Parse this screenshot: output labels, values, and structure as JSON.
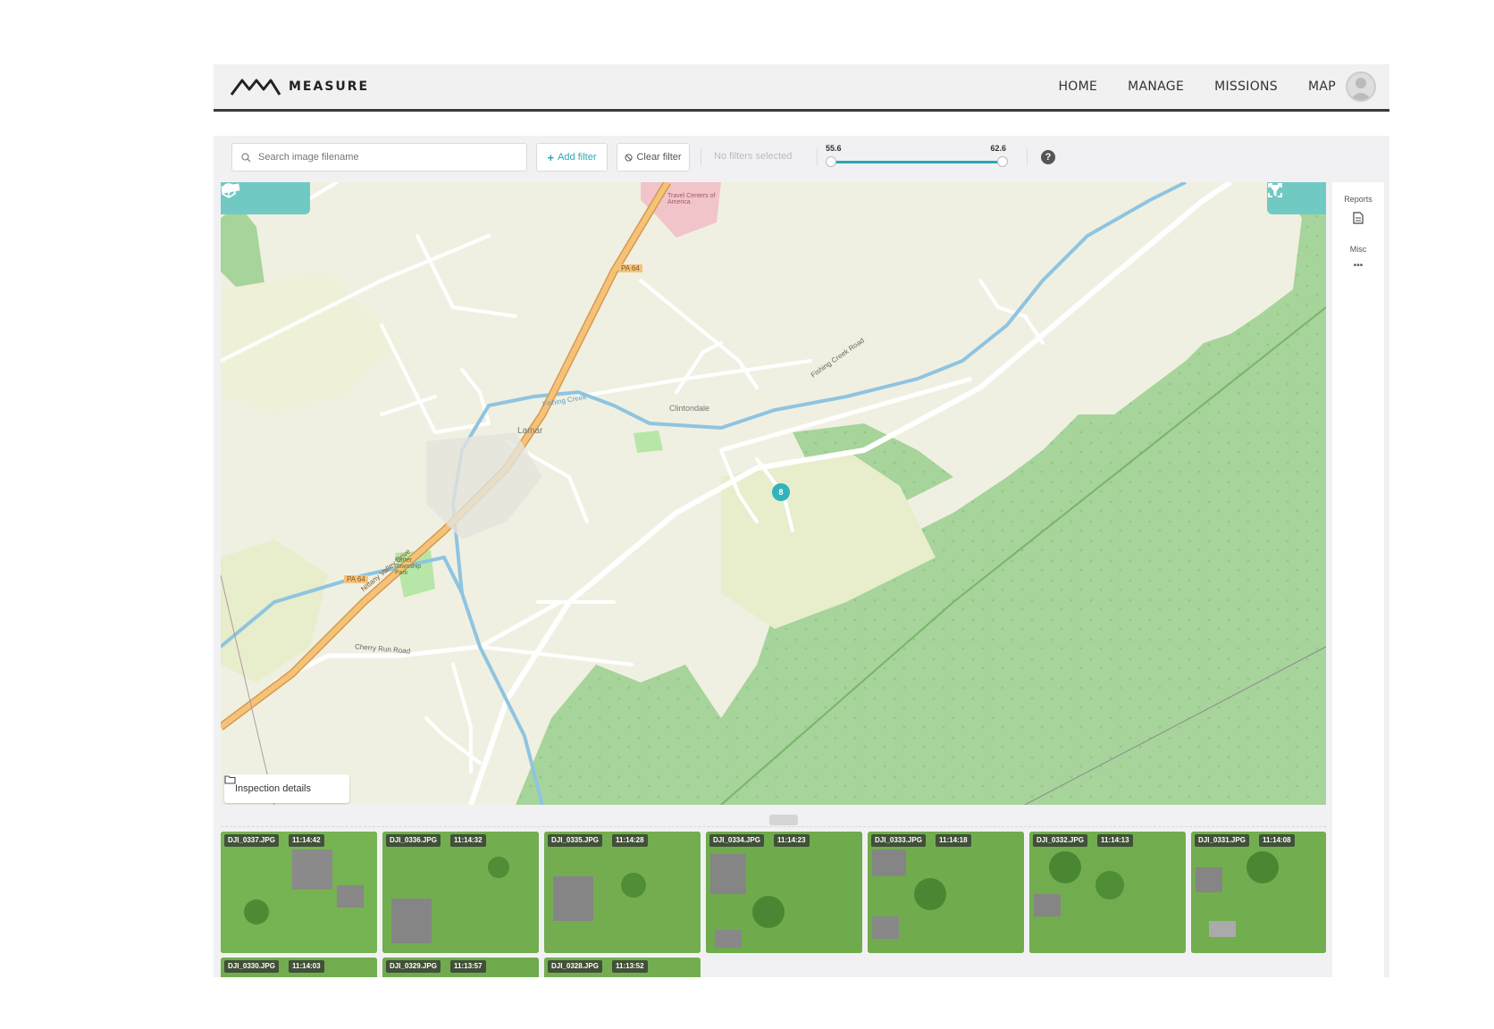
{
  "header": {
    "brand": "MEASURE",
    "nav": [
      "HOME",
      "MANAGE",
      "MISSIONS",
      "MAP"
    ]
  },
  "toolbar": {
    "search_placeholder": "Search image filename",
    "add_filter_label": "Add filter",
    "clear_filter_label": "Clear filter",
    "no_filters_text": "No filters selected",
    "slider_min": "55.6",
    "slider_max": "62.6",
    "help_label": "?"
  },
  "map": {
    "labels": {
      "place": "Lamar",
      "creek": "Fishing Creek",
      "road1": "Nittany Valley Drive",
      "route": "PA 64",
      "cherry": "Cherry Run Road",
      "fishing_road": "Fishing Creek Road",
      "park": "Porter Township Park",
      "village": "Clintondale",
      "travel": "Travel Centers of America"
    },
    "pin_label": "8",
    "inspection_label": "Inspection details"
  },
  "side": {
    "reports_label": "Reports",
    "misc_label": "Misc",
    "more_label": "•••"
  },
  "thumbnails": [
    {
      "name": "DJI_0337.JPG",
      "time": "11:14:42"
    },
    {
      "name": "DJI_0336.JPG",
      "time": "11:14:32"
    },
    {
      "name": "DJI_0335.JPG",
      "time": "11:14:28"
    },
    {
      "name": "DJI_0334.JPG",
      "time": "11:14:23"
    },
    {
      "name": "DJI_0333.JPG",
      "time": "11:14:18"
    },
    {
      "name": "DJI_0332.JPG",
      "time": "11:14:13"
    },
    {
      "name": "DJI_0331.JPG",
      "time": "11:14:08"
    },
    {
      "name": "DJI_0330.JPG",
      "time": "11:14:03"
    },
    {
      "name": "DJI_0329.JPG",
      "time": "11:13:57"
    },
    {
      "name": "DJI_0328.JPG",
      "time": "11:13:52"
    }
  ],
  "colors": {
    "accent": "#2aa8b5",
    "forest": "#a6d49a",
    "land": "#f0f0e2",
    "road_major": "#f0b35e",
    "water": "#8fc4e0"
  }
}
